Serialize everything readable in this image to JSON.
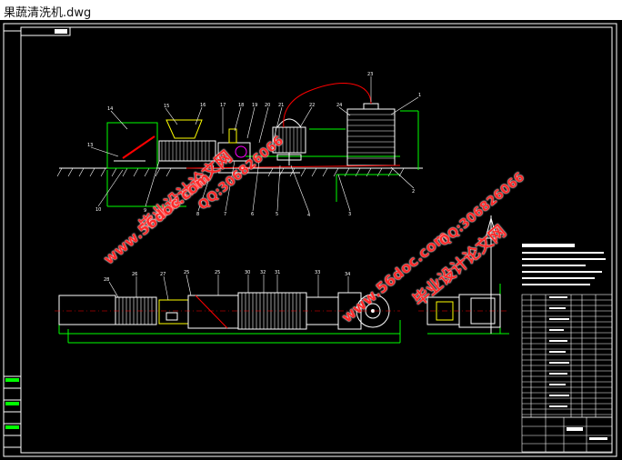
{
  "window": {
    "title": "果蔬清洗机.dwg"
  },
  "colors": {
    "background": "#000000",
    "frame": "#ffffff",
    "green": "#00ff00",
    "red": "#ff0000",
    "yellow": "#ffff00",
    "magenta": "#ff00ff",
    "cyan": "#00ffff",
    "watermark": "#ff2a2a"
  },
  "drawing": {
    "top_parts": [
      "14",
      "15",
      "16",
      "17",
      "18",
      "19",
      "20",
      "21",
      "22",
      "23",
      "24",
      "1"
    ],
    "bottom_parts": [
      "10",
      "9",
      "8",
      "7",
      "6",
      "5",
      "4",
      "3",
      "2"
    ],
    "plan_parts": [
      "28",
      "27",
      "26",
      "25",
      "30",
      "32",
      "31",
      "33",
      "34"
    ],
    "notes_title": "技术要求"
  },
  "watermarks": {
    "brand": "毕业设计论文网",
    "site": "www.56doc.com",
    "qq": "QQ:306826066"
  }
}
